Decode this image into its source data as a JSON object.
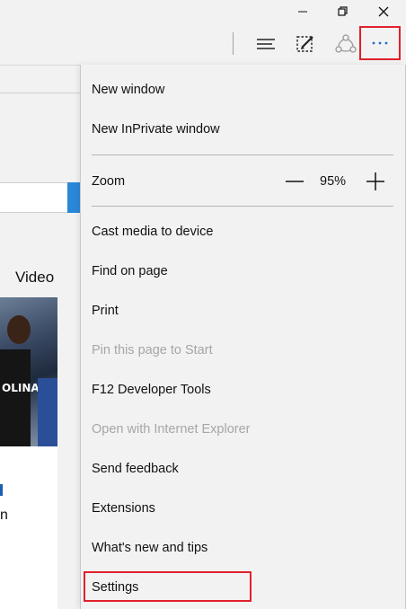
{
  "window_controls": {
    "minimize": "—",
    "restore": "❐",
    "close": "✕"
  },
  "toolbar": {
    "hub_icon": "hub-icon",
    "web_note_icon": "web-note-icon",
    "share_icon": "share-icon",
    "more_label": "···"
  },
  "background_page": {
    "video_tab": "Video",
    "image_jersey_text": "OLINA",
    "partial_text": "n"
  },
  "menu": {
    "new_window": "New window",
    "new_inprivate_window": "New InPrivate window",
    "zoom_label": "Zoom",
    "zoom_value": "95%",
    "cast_media": "Cast media to device",
    "find_on_page": "Find on page",
    "print": "Print",
    "pin_to_start": "Pin this page to Start",
    "f12_tools": "F12 Developer Tools",
    "open_with_ie": "Open with Internet Explorer",
    "send_feedback": "Send feedback",
    "extensions": "Extensions",
    "whats_new": "What's new and tips",
    "settings": "Settings"
  },
  "colors": {
    "highlight_border": "#e0202a",
    "accent_blue": "#1e6ec8",
    "disabled_text": "#a6a6a6"
  }
}
